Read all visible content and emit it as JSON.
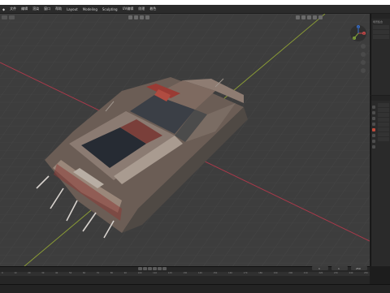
{
  "app": {
    "name": "Blender 3D viewport"
  },
  "menubar": {
    "items": [
      "文件",
      "编辑",
      "渲染",
      "窗口",
      "帮助",
      "Layout",
      "Modeling",
      "Sculpting",
      "UV编辑",
      "纹理",
      "着色"
    ]
  },
  "viewport": {
    "object": "post-apocalyptic car model",
    "colors": {
      "grid_bg": "#3d3d3d",
      "x_axis": "#b53a4a",
      "y_axis": "#8fa23a"
    }
  },
  "gizmo": {
    "x_label": "X",
    "y_label": "Y",
    "z_label": "Z"
  },
  "outliner": {
    "title": "场景集合"
  },
  "properties": {
    "tabs": 8
  },
  "timeline": {
    "frame_current": "1",
    "frame_start": "1",
    "frame_end": "250",
    "ticks": [
      "0",
      "10",
      "20",
      "30",
      "40",
      "50",
      "60",
      "70",
      "80",
      "90",
      "100",
      "110",
      "120",
      "130",
      "140",
      "150",
      "160",
      "170",
      "180",
      "190",
      "200",
      "210",
      "220",
      "230",
      "240",
      "250"
    ]
  }
}
